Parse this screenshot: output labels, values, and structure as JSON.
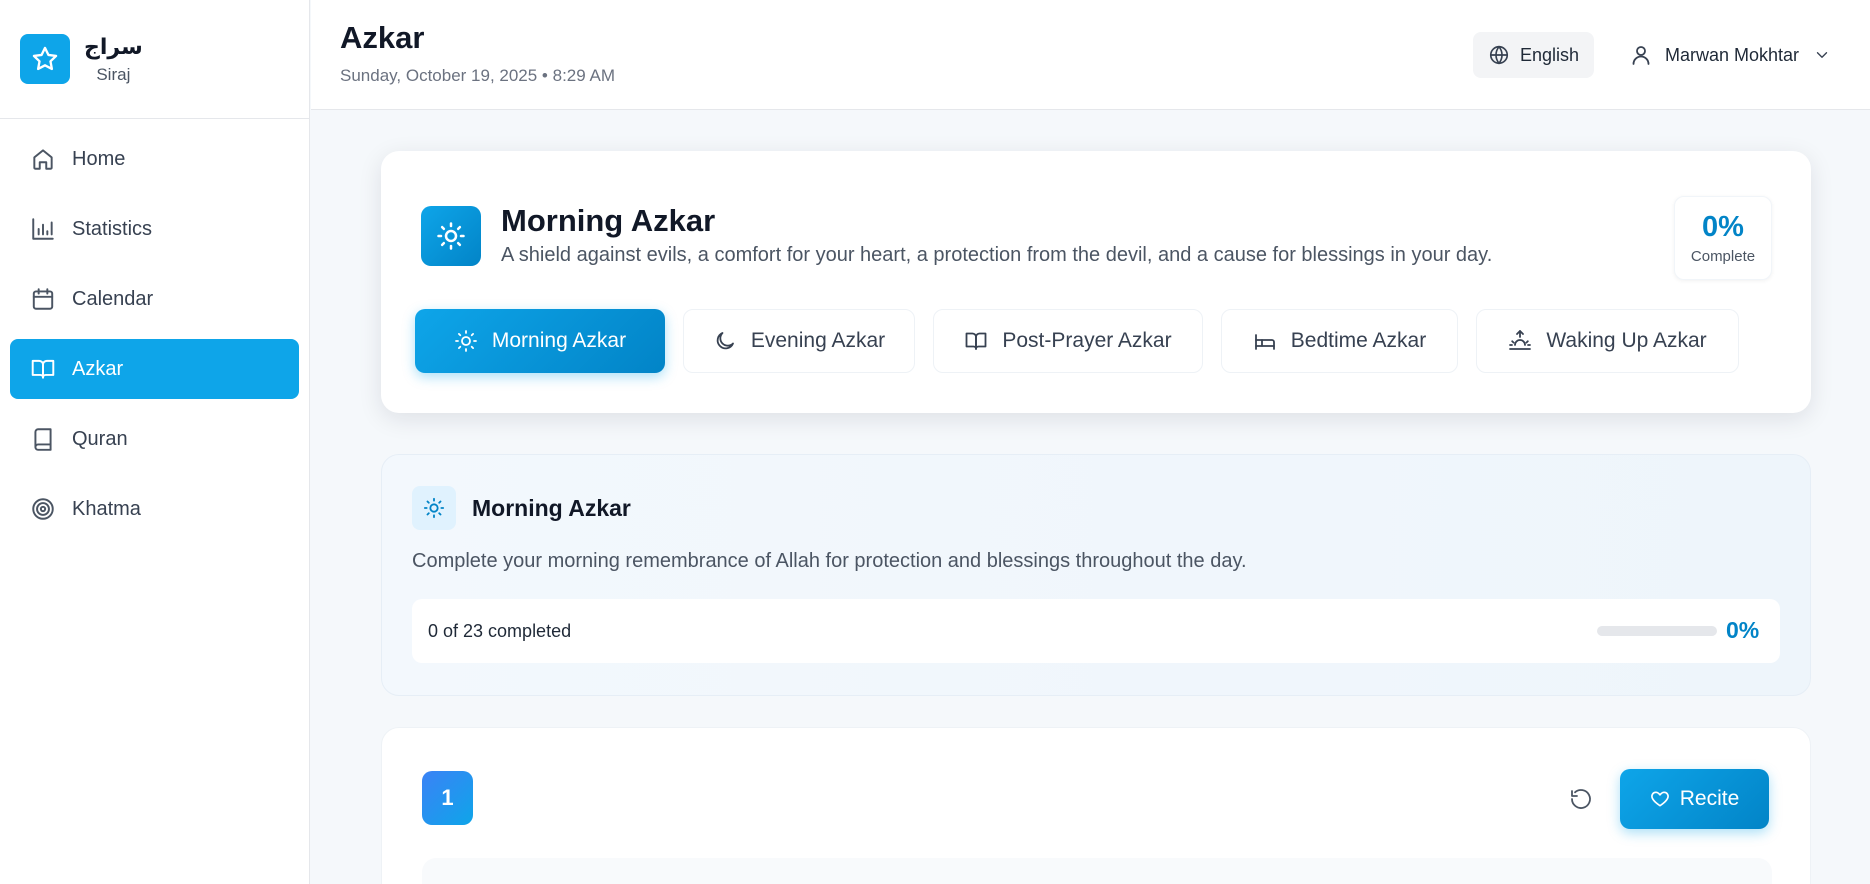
{
  "brand": {
    "name_ar": "سراج",
    "name_en": "Siraj",
    "icon": "star-icon"
  },
  "sidebar": {
    "items": [
      {
        "label": "Home",
        "icon": "home-icon",
        "active": false
      },
      {
        "label": "Statistics",
        "icon": "bar-chart-icon",
        "active": false
      },
      {
        "label": "Calendar",
        "icon": "calendar-icon",
        "active": false
      },
      {
        "label": "Azkar",
        "icon": "open-book-icon",
        "active": true
      },
      {
        "label": "Quran",
        "icon": "book-icon",
        "active": false
      },
      {
        "label": "Khatma",
        "icon": "target-icon",
        "active": false
      }
    ]
  },
  "header": {
    "title": "Azkar",
    "datetime": "Sunday, October 19, 2025 • 8:29 AM",
    "language_label": "English",
    "user_name": "Marwan Mokhtar"
  },
  "hero": {
    "title": "Morning Azkar",
    "description": "A shield against evils, a comfort for your heart, a protection from the devil, and a cause for blessings in your day.",
    "percent": "0%",
    "percent_label": "Complete"
  },
  "tabs": [
    {
      "label": "Morning Azkar",
      "icon": "sun-icon",
      "active": true
    },
    {
      "label": "Evening Azkar",
      "icon": "moon-icon",
      "active": false
    },
    {
      "label": "Post-Prayer Azkar",
      "icon": "open-book-icon",
      "active": false
    },
    {
      "label": "Bedtime Azkar",
      "icon": "bed-icon",
      "active": false
    },
    {
      "label": "Waking Up Azkar",
      "icon": "sunrise-icon",
      "active": false
    }
  ],
  "section": {
    "title": "Morning Azkar",
    "description": "Complete your morning remembrance of Allah for protection and blessings throughout the day.",
    "progress_text": "0 of 23 completed",
    "progress_percent": "0%",
    "progress_fraction": 0
  },
  "zikr": {
    "number": "1",
    "recite_label": "Recite"
  },
  "colors": {
    "accent": "#0ea5e9",
    "accent_dark": "#0284c7"
  }
}
